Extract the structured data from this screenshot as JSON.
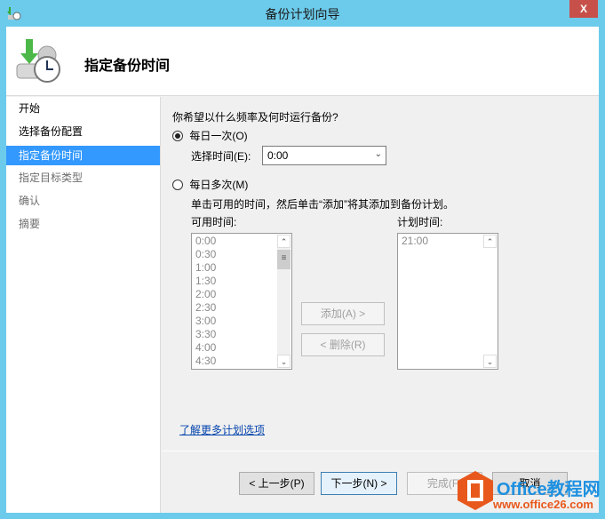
{
  "window": {
    "title": "备份计划向导",
    "close_label": "X"
  },
  "header": {
    "title": "指定备份时间"
  },
  "nav": {
    "items": [
      "开始",
      "选择备份配置",
      "指定备份时间",
      "指定目标类型",
      "确认",
      "摘要"
    ]
  },
  "main": {
    "question": "你希望以什么频率及何时运行备份?",
    "once_label": "每日一次(O)",
    "select_time_label": "选择时间(E):",
    "select_time_value": "0:00",
    "multi_label": "每日多次(M)",
    "instruction": "单击可用的时间，然后单击“添加”将其添加到备份计划。",
    "available_label": "可用时间:",
    "available_times": [
      "0:00",
      "0:30",
      "1:00",
      "1:30",
      "2:00",
      "2:30",
      "3:00",
      "3:30",
      "4:00",
      "4:30"
    ],
    "scheduled_label": "计划时间:",
    "scheduled_times": [
      "21:00"
    ],
    "add_button": "添加(A) >",
    "remove_button": "< 删除(R)",
    "learn_more": "了解更多计划选项"
  },
  "footer": {
    "back": "< 上一步(P)",
    "next": "下一步(N) >",
    "finish": "完成(F)",
    "cancel": "取消"
  },
  "watermark": {
    "brand": "Office教程网",
    "url": "www.office26.com"
  }
}
